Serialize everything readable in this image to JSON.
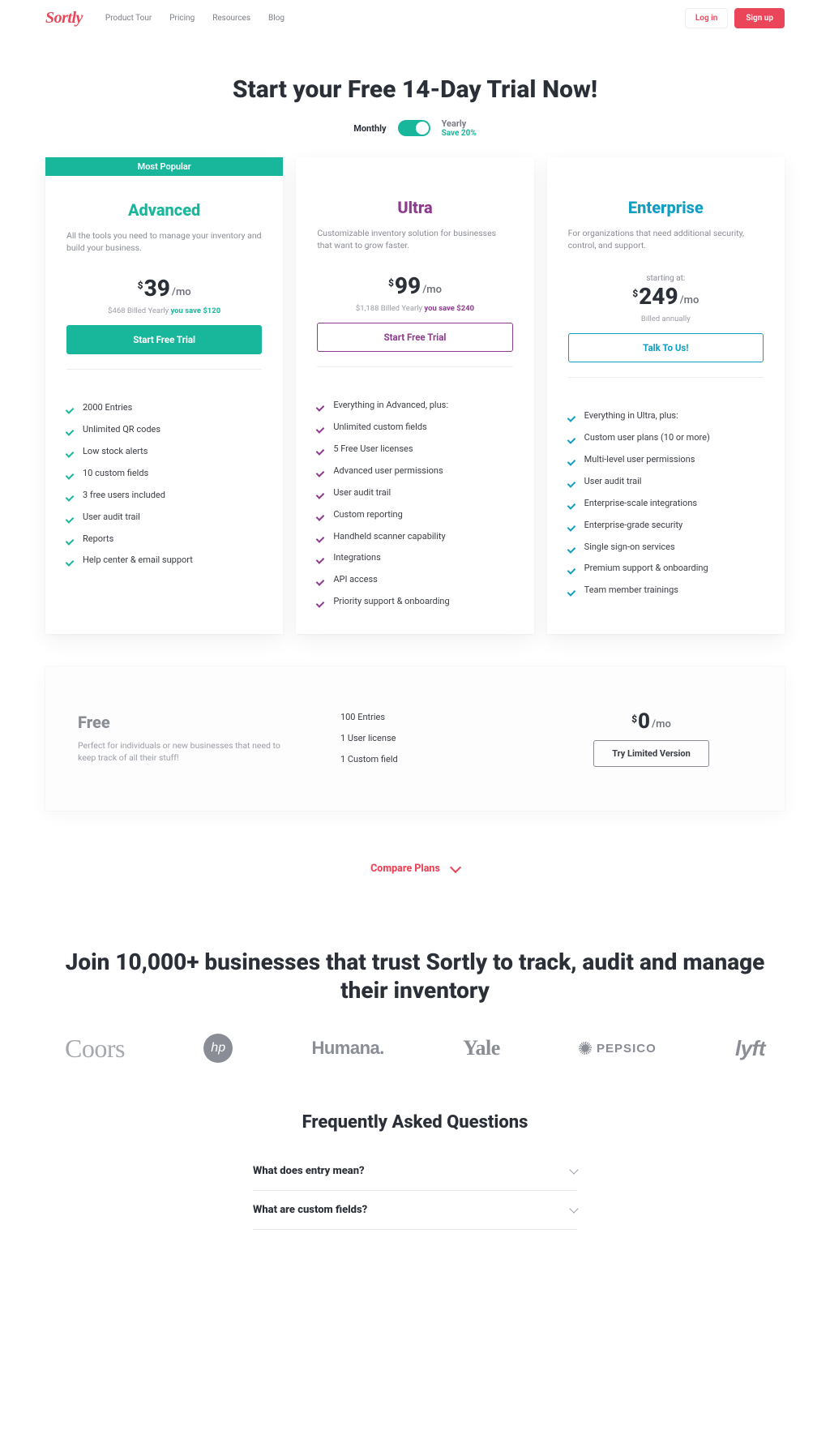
{
  "brand": "Sortly",
  "nav": {
    "items": [
      "Product Tour",
      "Pricing",
      "Resources",
      "Blog"
    ]
  },
  "header": {
    "login": "Log in",
    "signup": "Sign up"
  },
  "hero": {
    "title": "Start your Free 14-Day Trial Now!"
  },
  "toggle": {
    "monthly": "Monthly",
    "yearly": "Yearly",
    "save": "Save 20%"
  },
  "plans": [
    {
      "id": "advanced",
      "badge": "Most Popular",
      "title": "Advanced",
      "desc": "All the tools you need to manage your inventory and build your business.",
      "currency": "$",
      "price": "39",
      "per": "/mo",
      "billed_prefix": "$468 Billed Yearly ",
      "billed_save": "you save $120",
      "cta": "Start Free Trial",
      "features": [
        "2000 Entries",
        "Unlimited QR codes",
        "Low stock alerts",
        "10 custom fields",
        "3 free users included",
        "User audit trail",
        "Reports",
        "Help center & email support"
      ]
    },
    {
      "id": "ultra",
      "title": "Ultra",
      "desc": "Customizable inventory solution for businesses that want to grow faster.",
      "currency": "$",
      "price": "99",
      "per": "/mo",
      "billed_prefix": "$1,188 Billed Yearly ",
      "billed_save": "you save $240",
      "cta": "Start Free Trial",
      "features": [
        "Everything in Advanced, plus:",
        "Unlimited custom fields",
        "5 Free User licenses",
        "Advanced user permissions",
        "User audit trail",
        "Custom reporting",
        "Handheld scanner capability",
        "Integrations",
        "API access",
        "Priority support & onboarding"
      ]
    },
    {
      "id": "enterprise",
      "title": "Enterprise",
      "desc": "For organizations that need additional security, control, and support.",
      "starting": "starting at:",
      "currency": "$",
      "price": "249",
      "per": "/mo",
      "billed_prefix": "Billed annually",
      "cta": "Talk To Us!",
      "features": [
        "Everything in Ultra, plus:",
        "Custom user plans (10 or more)",
        "Multi-level user permissions",
        "User audit trail",
        "Enterprise-scale integrations",
        "Enterprise-grade security",
        "Single sign-on services",
        "Premium support & onboarding",
        "Team member trainings"
      ]
    }
  ],
  "free": {
    "title": "Free",
    "desc": "Perfect for individuals or new businesses that need to keep track of all their stuff!",
    "features": [
      "100 Entries",
      "1 User license",
      "1 Custom field"
    ],
    "currency": "$",
    "price": "0",
    "per": "/mo",
    "cta": "Try Limited Version"
  },
  "compare": "Compare Plans",
  "proof": "Join 10,000+ businesses that trust Sortly to track, audit and manage their inventory",
  "logos": {
    "coors": "Coors",
    "hp": "hp",
    "humana": "Humana.",
    "yale": "Yale",
    "pepsi": "PEPSICO",
    "lyft": "lyft"
  },
  "faq": {
    "title": "Frequently Asked Questions",
    "items": [
      "What does entry mean?",
      "What are custom fields?"
    ]
  }
}
